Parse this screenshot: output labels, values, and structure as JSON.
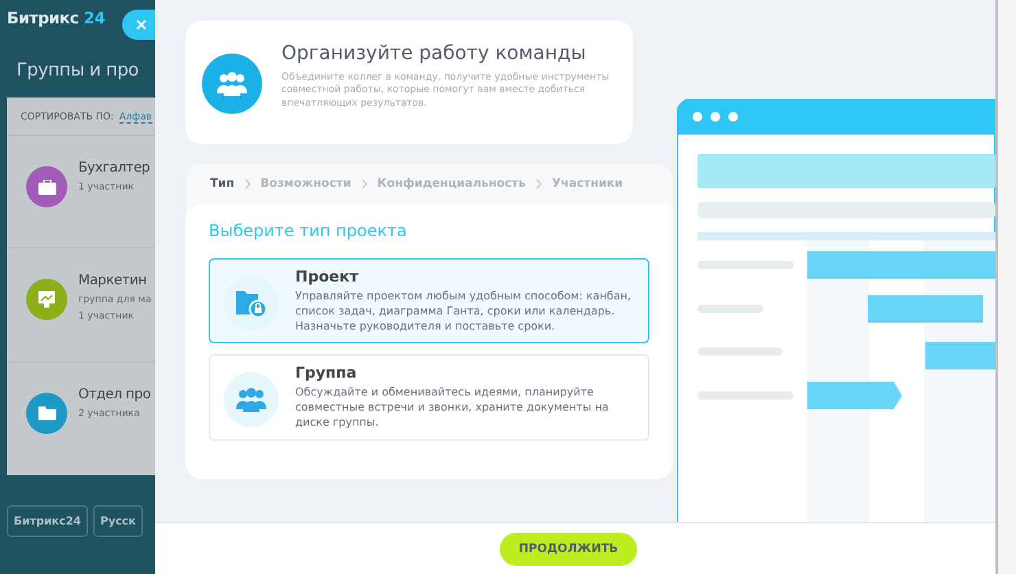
{
  "background": {
    "logo": {
      "name": "Битрикс",
      "number": "24"
    },
    "title": "Группы и про",
    "sort": {
      "label": "СОРТИРОВАТЬ ПО:",
      "value": "Алфав"
    },
    "groups": [
      {
        "name": "Бухгалтер",
        "members": "1 участник",
        "color": "#a05cb8",
        "kind": "briefcase"
      },
      {
        "name": "Маркетин",
        "description": "группа для ма",
        "members": "1 участник",
        "color": "#8db01a",
        "kind": "chart"
      },
      {
        "name": "Отдел про",
        "members": "2 участника",
        "color": "#1f9ac6",
        "kind": "folder"
      }
    ],
    "footer": [
      "Битрикс24",
      "Русск"
    ]
  },
  "intro": {
    "title": "Организуйте работу команды",
    "text": "Объедините коллег в команду, получите удобные инструменты совместной работы, которые помогут вам вместе добиться впечатляющих результатов."
  },
  "steps": [
    {
      "label": "Тип",
      "selected": true
    },
    {
      "label": "Возможности",
      "selected": false
    },
    {
      "label": "Конфиденциальность",
      "selected": false
    },
    {
      "label": "Участники",
      "selected": false
    }
  ],
  "heading": "Выберите тип проекта",
  "options": [
    {
      "kind": "project",
      "title": "Проект",
      "text": "Управляйте проектом любым удобным способом: канбан, список задач, диаграмма Ганта, сроки или календарь. Назначьте руководителя и поставьте сроки.",
      "selected": true
    },
    {
      "kind": "group",
      "title": "Группа",
      "text": "Обсуждайте и обменивайтесь идеями, планируйте совместные встречи и звонки, храните документы на диске группы.",
      "selected": false
    }
  ],
  "continue_button": "ПРОДОЛЖИТЬ"
}
